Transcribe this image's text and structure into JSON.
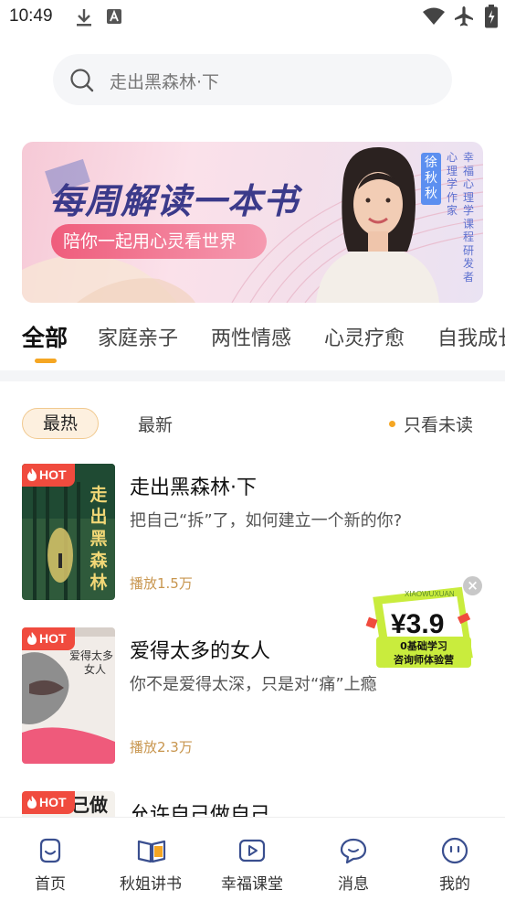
{
  "status_bar": {
    "time": "10:49"
  },
  "search": {
    "placeholder": "走出黑森林·下"
  },
  "banner": {
    "title": "每周解读一本书",
    "subtitle": "陪你一起用心灵看世界",
    "name_tag": "徐秋秋",
    "role_1": "心理学作家",
    "role_2": "幸福心理学课程研发者"
  },
  "categories": [
    "全部",
    "家庭亲子",
    "两性情感",
    "心灵疗愈",
    "自我成长"
  ],
  "filters": {
    "hot": "最热",
    "latest": "最新",
    "unread_only": "只看未读"
  },
  "books": [
    {
      "title": "走出黑森林·下",
      "desc": "把自己“拆”了，如何建立一个新的你?",
      "plays": "播放1.5万",
      "badge": "HOT",
      "cover_text": "走出黑森林"
    },
    {
      "title": "爱得太多的女人",
      "desc": "你不是爱得太深，只是对“痛”上瘾",
      "plays": "播放2.3万",
      "badge": "HOT",
      "cover_text": "爱得太多的女人"
    },
    {
      "title": "允许自己做自己",
      "desc": "",
      "plays": "",
      "badge": "HOT",
      "cover_text": "己做"
    }
  ],
  "float_ad": {
    "price": "¥3.9",
    "line1": "0基础学习",
    "line2": "咨询师体验营",
    "brand": "XIAOWUXUAN"
  },
  "bottom_nav": [
    {
      "label": "首页",
      "icon": "smile-icon"
    },
    {
      "label": "秋姐讲书",
      "icon": "open-book-icon"
    },
    {
      "label": "幸福课堂",
      "icon": "play-icon"
    },
    {
      "label": "消息",
      "icon": "chat-icon"
    },
    {
      "label": "我的",
      "icon": "profile-face-icon"
    }
  ],
  "colors": {
    "accent": "#f5a623",
    "hot": "#f04b3e",
    "plays": "#c8964f",
    "tab_text": "#333333"
  }
}
